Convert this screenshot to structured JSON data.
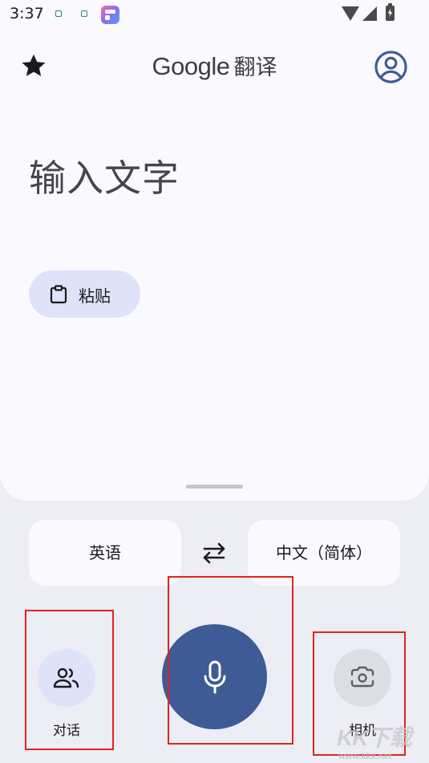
{
  "status_bar": {
    "time": "3:37"
  },
  "header": {
    "brand": "Google",
    "product": "翻译",
    "icons": {
      "left": "star-icon",
      "right": "account-circle-icon"
    }
  },
  "input": {
    "placeholder": "输入文字",
    "paste_label": "粘贴"
  },
  "languages": {
    "source": "英语",
    "target": "中文（简体）",
    "swap_icon": "swap-arrows-icon"
  },
  "actions": {
    "conversation_label": "对话",
    "camera_label": "相机",
    "mic_icon": "microphone-icon"
  },
  "watermark": {
    "text": "KK下载",
    "url": "www.kkx.net"
  },
  "colors": {
    "panel": "#FAF9FE",
    "background": "#ECEDF5",
    "mic": "#3E5B96",
    "accent_chip": "#DEE3FA",
    "account_icon": "#3E5B96",
    "highlight": "#E3231D"
  }
}
